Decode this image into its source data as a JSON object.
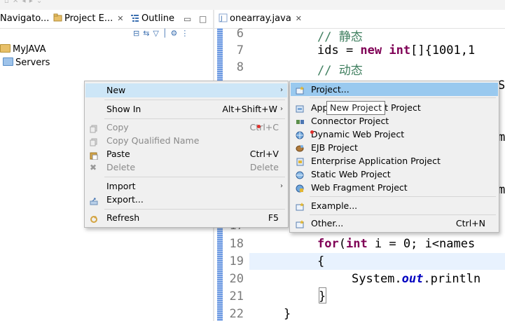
{
  "left_tabs": {
    "navigator": "Navigato...",
    "project_explorer": "Project E...",
    "outline": "Outline"
  },
  "tree": {
    "items": [
      "MyJAVA",
      "Servers"
    ]
  },
  "editor": {
    "tab_title": "onearray.java",
    "lines": [
      {
        "num": "6",
        "text": "// 静态"
      },
      {
        "num": "7",
        "text": "ids = new int[]{1001,1"
      },
      {
        "num": "8",
        "text": "// 动态"
      },
      {
        "num": "17",
        "text": ""
      },
      {
        "num": "18",
        "text": "for(int i = 0; i<names"
      },
      {
        "num": "19",
        "text": "{"
      },
      {
        "num": "20",
        "text": "System.out.println"
      },
      {
        "num": "21",
        "text": "}"
      },
      {
        "num": "22",
        "text": "}"
      }
    ],
    "right_edge_chars": [
      "S",
      "m",
      "m"
    ]
  },
  "context_menu": {
    "items": [
      {
        "label": "New",
        "accel": "",
        "submenu": true,
        "state": "selected"
      },
      {
        "label": "Show In",
        "accel": "Alt+Shift+W",
        "submenu": true,
        "state": "normal"
      },
      {
        "label": "Copy",
        "accel": "Ctrl+C",
        "submenu": false,
        "state": "disabled"
      },
      {
        "label": "Copy Qualified Name",
        "accel": "",
        "submenu": false,
        "state": "disabled"
      },
      {
        "label": "Paste",
        "accel": "Ctrl+V",
        "submenu": false,
        "state": "normal"
      },
      {
        "label": "Delete",
        "accel": "Delete",
        "submenu": false,
        "state": "disabled"
      },
      {
        "label": "Import",
        "accel": "",
        "submenu": true,
        "state": "normal"
      },
      {
        "label": "Export...",
        "accel": "",
        "submenu": false,
        "state": "normal"
      },
      {
        "label": "Refresh",
        "accel": "F5",
        "submenu": false,
        "state": "normal"
      }
    ]
  },
  "new_submenu": {
    "items": [
      {
        "label": "Project...",
        "accel": ""
      },
      {
        "label": "Application Client Project",
        "accel": ""
      },
      {
        "label": "Connector Project",
        "accel": ""
      },
      {
        "label": "Dynamic Web Project",
        "accel": ""
      },
      {
        "label": "EJB Project",
        "accel": ""
      },
      {
        "label": "Enterprise Application Project",
        "accel": ""
      },
      {
        "label": "Static Web Project",
        "accel": ""
      },
      {
        "label": "Web Fragment Project",
        "accel": ""
      },
      {
        "label": "Example...",
        "accel": ""
      },
      {
        "label": "Other...",
        "accel": "Ctrl+N"
      }
    ]
  },
  "tooltip": "New Project",
  "colors": {
    "keyword": "#7f0055",
    "comment": "#3f7f5f",
    "field": "#0000c0",
    "menu_hover": "#cde6f7",
    "submenu_hover": "#99c9ef"
  }
}
